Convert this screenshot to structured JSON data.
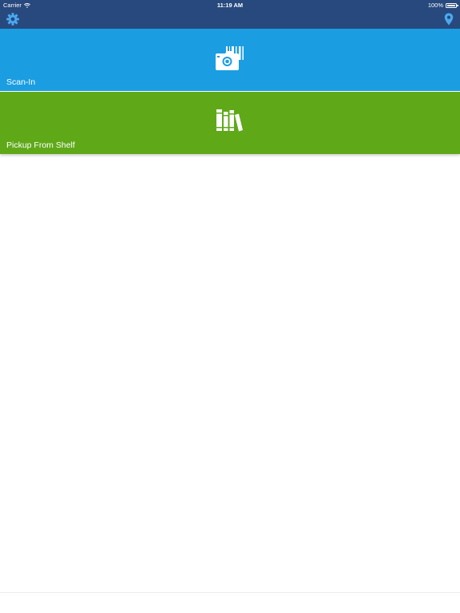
{
  "status_bar": {
    "carrier": "Carrier",
    "time": "11:19 AM",
    "battery": "100%",
    "icons": [
      "wifi-icon",
      "battery-icon"
    ]
  },
  "nav_bar": {
    "background": "#27497d",
    "left_icon": "gear-icon",
    "right_icon": "location-pin-icon",
    "icon_color": "#4aa8ef"
  },
  "tiles": [
    {
      "label": "Scan-In",
      "icon": "camera-barcode-icon",
      "color": "#1b9de2"
    },
    {
      "label": "Pickup From Shelf",
      "icon": "books-icon",
      "color": "#5fa919"
    }
  ]
}
